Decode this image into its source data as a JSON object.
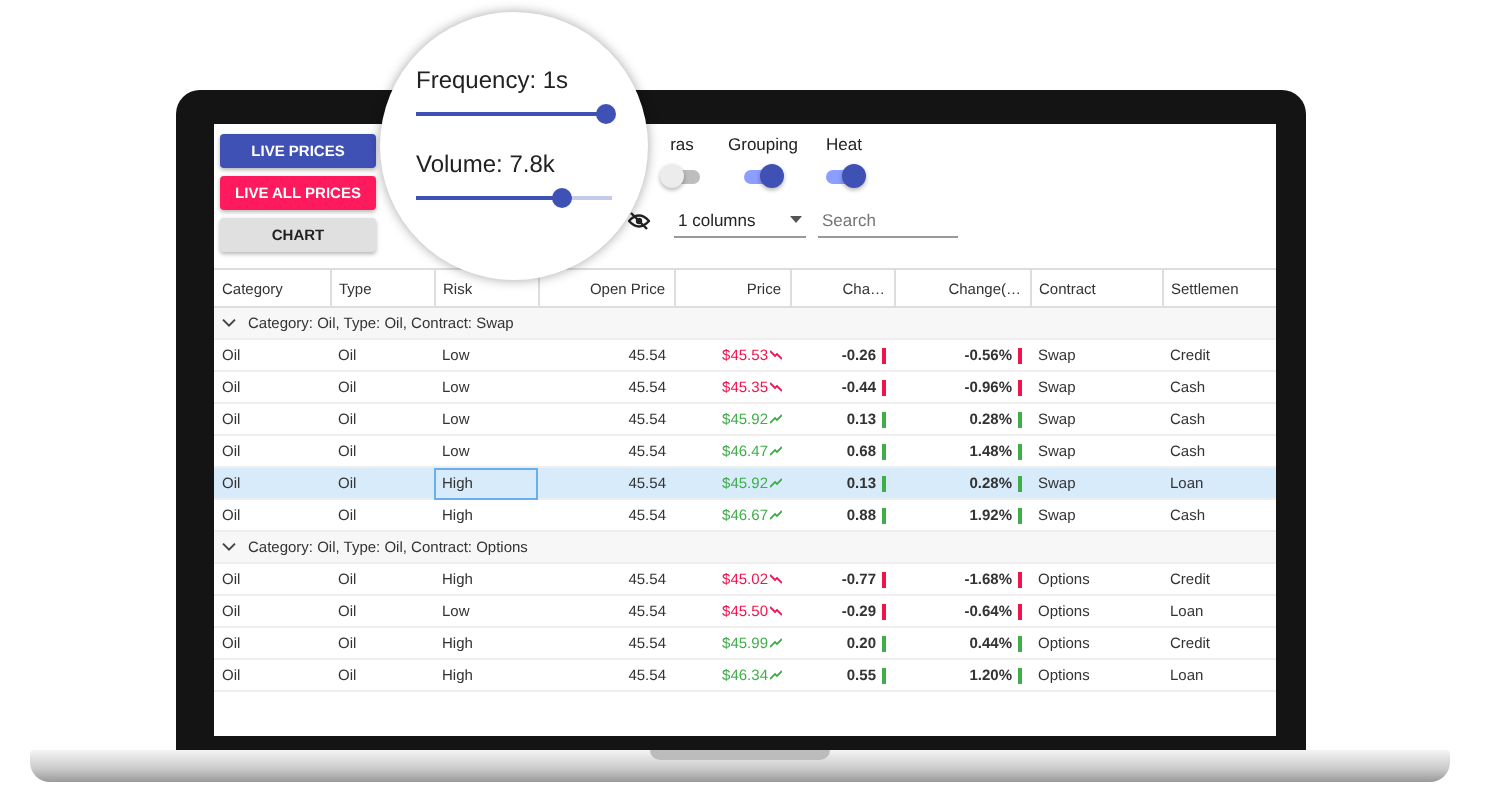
{
  "toolbar": {
    "buttons": [
      {
        "label": "LIVE PRICES",
        "kind": "primary"
      },
      {
        "label": "LIVE ALL PRICES",
        "kind": "accent"
      },
      {
        "label": "CHART",
        "kind": "plain"
      }
    ],
    "toggles": [
      {
        "label": "ras",
        "on": false
      },
      {
        "label": "Grouping",
        "on": true
      },
      {
        "label": "Heat",
        "on": true
      }
    ],
    "columns_select": {
      "value": "1 columns"
    },
    "search": {
      "placeholder": "Search"
    }
  },
  "magnifier": {
    "sliders": [
      {
        "label": "Frequency: 1s",
        "level": 0.97
      },
      {
        "label": "Volume: 7.8k",
        "level": 0.74
      }
    ]
  },
  "table": {
    "columns": [
      "Category",
      "Type",
      "Risk",
      "Open Price",
      "Price",
      "Cha…",
      "Change(…",
      "Contract",
      "Settlemen"
    ],
    "groups": [
      {
        "label": "Category: Oil, Type: Oil, Contract: Swap",
        "expanded": true,
        "rows": [
          {
            "cells": [
              "Oil",
              "Oil",
              "Low",
              "45.54",
              "$45.53",
              "-0.26",
              "-0.56%",
              "Swap",
              "Credit"
            ],
            "rising": false,
            "selected": false,
            "focused": false
          },
          {
            "cells": [
              "Oil",
              "Oil",
              "Low",
              "45.54",
              "$45.35",
              "-0.44",
              "-0.96%",
              "Swap",
              "Cash"
            ],
            "rising": false,
            "selected": false,
            "focused": false
          },
          {
            "cells": [
              "Oil",
              "Oil",
              "Low",
              "45.54",
              "$45.92",
              "0.13",
              "0.28%",
              "Swap",
              "Cash"
            ],
            "rising": true,
            "selected": false,
            "focused": false
          },
          {
            "cells": [
              "Oil",
              "Oil",
              "Low",
              "45.54",
              "$46.47",
              "0.68",
              "1.48%",
              "Swap",
              "Cash"
            ],
            "rising": true,
            "selected": false,
            "focused": false
          },
          {
            "cells": [
              "Oil",
              "Oil",
              "High",
              "45.54",
              "$45.92",
              "0.13",
              "0.28%",
              "Swap",
              "Loan"
            ],
            "rising": true,
            "selected": true,
            "focused": true
          },
          {
            "cells": [
              "Oil",
              "Oil",
              "High",
              "45.54",
              "$46.67",
              "0.88",
              "1.92%",
              "Swap",
              "Cash"
            ],
            "rising": true,
            "selected": false,
            "focused": false
          }
        ]
      },
      {
        "label": "Category: Oil, Type: Oil, Contract: Options",
        "expanded": true,
        "rows": [
          {
            "cells": [
              "Oil",
              "Oil",
              "High",
              "45.54",
              "$45.02",
              "-0.77",
              "-1.68%",
              "Options",
              "Credit"
            ],
            "rising": false,
            "selected": false,
            "focused": false
          },
          {
            "cells": [
              "Oil",
              "Oil",
              "Low",
              "45.54",
              "$45.50",
              "-0.29",
              "-0.64%",
              "Options",
              "Loan"
            ],
            "rising": false,
            "selected": false,
            "focused": false
          },
          {
            "cells": [
              "Oil",
              "Oil",
              "High",
              "45.54",
              "$45.99",
              "0.20",
              "0.44%",
              "Options",
              "Credit"
            ],
            "rising": true,
            "selected": false,
            "focused": false
          },
          {
            "cells": [
              "Oil",
              "Oil",
              "High",
              "45.54",
              "$46.34",
              "0.55",
              "1.20%",
              "Options",
              "Loan"
            ],
            "rising": true,
            "selected": false,
            "focused": false
          }
        ]
      }
    ]
  }
}
